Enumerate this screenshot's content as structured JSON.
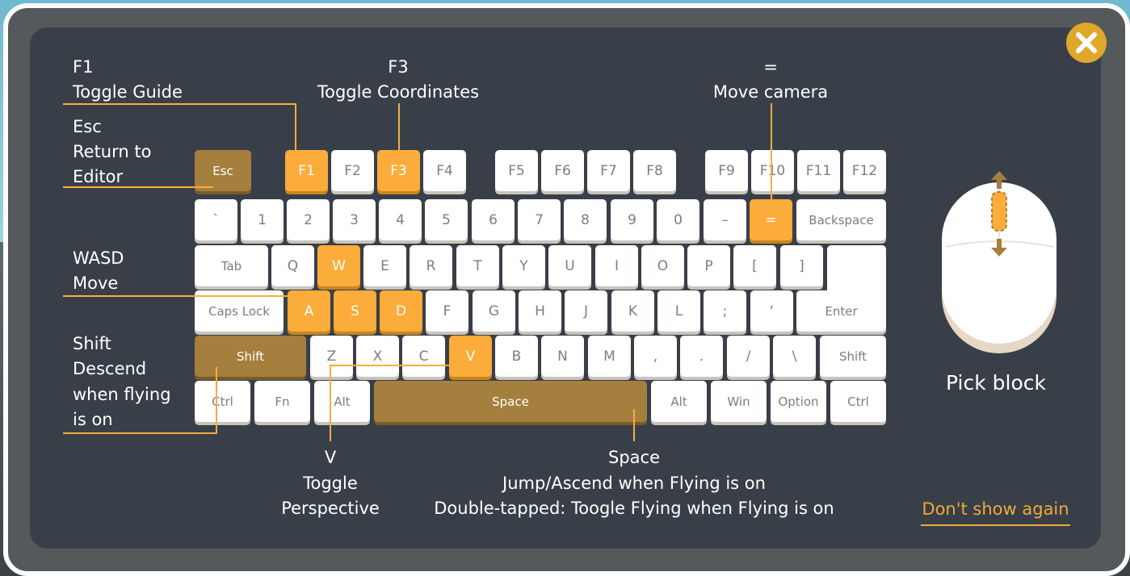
{
  "annotations": {
    "f1": {
      "key": "F1",
      "action": "Toggle Guide"
    },
    "f3": {
      "key": "F3",
      "action": "Toggle Coordinates"
    },
    "equals": {
      "key": "=",
      "action": "Move camera"
    },
    "esc": {
      "key": "Esc",
      "line1": "Return to",
      "line2": "Editor"
    },
    "wasd": {
      "key": "WASD",
      "action": "Move"
    },
    "shift": {
      "key": "Shift",
      "line1": "Descend",
      "line2": "when flying",
      "line3": "is on"
    },
    "v": {
      "key": "V",
      "line1": "Toggle",
      "line2": "Perspective"
    },
    "space": {
      "key": "Space",
      "line1": "Jump/Ascend when Flying is on",
      "line2": "Double-tapped: Toogle Flying when Flying is on"
    }
  },
  "mouse": {
    "label": "Pick block"
  },
  "dont_show_again": "Don't show again",
  "keyboard": {
    "fn_row": [
      "Esc",
      "F1",
      "F2",
      "F3",
      "F4",
      "F5",
      "F6",
      "F7",
      "F8",
      "F9",
      "F10",
      "F11",
      "F12"
    ],
    "number_row": [
      "`",
      "1",
      "2",
      "3",
      "4",
      "5",
      "6",
      "7",
      "8",
      "9",
      "0",
      "–",
      "=",
      "Backspace"
    ],
    "qwerty_row": [
      "Tab",
      "Q",
      "W",
      "E",
      "R",
      "T",
      "Y",
      "U",
      "I",
      "O",
      "P",
      "[",
      "]"
    ],
    "home_row": [
      "Caps Lock",
      "A",
      "S",
      "D",
      "F",
      "G",
      "H",
      "J",
      "K",
      "L",
      ";",
      "‘",
      "Enter"
    ],
    "shift_row": [
      "Shift",
      "Z",
      "X",
      "C",
      "V",
      "B",
      "N",
      "M",
      ",",
      ".",
      "/",
      "\\",
      "Shift"
    ],
    "bottom_row": [
      "Ctrl",
      "Fn",
      "Alt",
      "Space",
      "Alt",
      "Win",
      "Option",
      "Ctrl"
    ]
  },
  "colors": {
    "highlight": "#fbac3a",
    "mapped": "#a57f3d",
    "panel": "#393f48",
    "accent": "#dfa82b"
  }
}
